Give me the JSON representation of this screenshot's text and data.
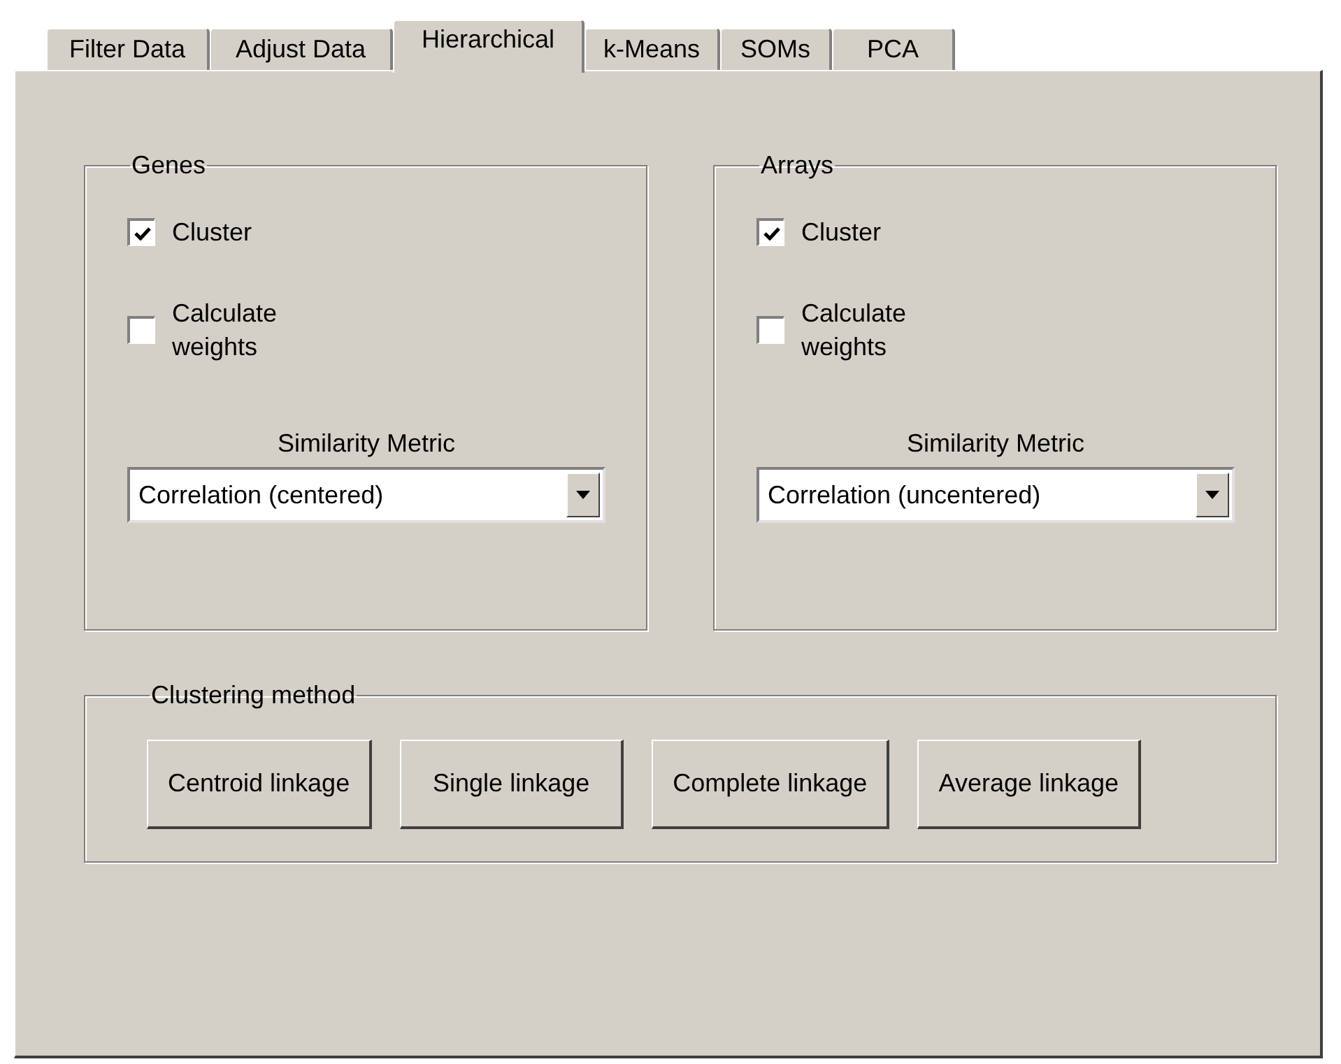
{
  "tabs": [
    {
      "label": "Filter Data",
      "selected": false
    },
    {
      "label": "Adjust Data",
      "selected": false
    },
    {
      "label": "Hierarchical",
      "selected": true
    },
    {
      "label": "k-Means",
      "selected": false
    },
    {
      "label": "SOMs",
      "selected": false
    },
    {
      "label": "PCA",
      "selected": false
    }
  ],
  "groups": [
    {
      "title": "Genes",
      "checkboxes": [
        {
          "label": "Cluster",
          "checked": true
        },
        {
          "label": "Calculate\nweights",
          "checked": false
        }
      ],
      "metric_label": "Similarity Metric",
      "metric_value": "Correlation (centered)"
    },
    {
      "title": "Arrays",
      "checkboxes": [
        {
          "label": "Cluster",
          "checked": true
        },
        {
          "label": "Calculate\nweights",
          "checked": false
        }
      ],
      "metric_label": "Similarity Metric",
      "metric_value": "Correlation (uncentered)"
    }
  ],
  "clustering_method": {
    "title": "Clustering method",
    "buttons": [
      "Centroid linkage",
      "Single linkage",
      "Complete linkage",
      "Average linkage"
    ]
  }
}
